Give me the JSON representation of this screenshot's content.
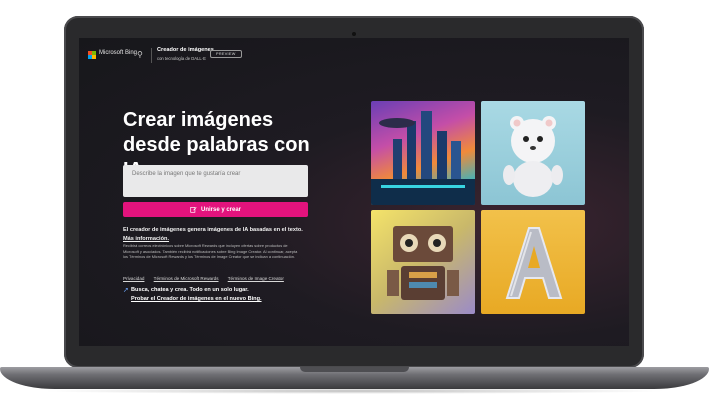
{
  "header": {
    "brand": "Microsoft Bing",
    "app_title": "Creador de imágenes",
    "app_subtitle": "con tecnología de DALL·E",
    "preview_badge": "PREVIEW"
  },
  "hero": {
    "title": "Crear imágenes desde palabras con IA",
    "input_placeholder": "Describe la imagen que te gustaría crear",
    "join_button": "Unirse y crear"
  },
  "description": {
    "text": "El creador de imágenes genera imágenes de IA basadas en el texto.",
    "more_link": "Más información."
  },
  "legal_text": "Recibirá correos electrónicos sobre Microsoft Rewards que incluyen ofertas sobre productos de Microsoft y asociados. También recibirá notificaciones sobre Bing Image Creator. Al continuar, acepta los Términos de Microsoft Rewards y los Términos de Image Creator que se indican a continuación.",
  "footer_links": [
    "Privacidad",
    "Términos de Microsoft Rewards",
    "Términos de Image Creator"
  ],
  "promo": {
    "line1": "Busca, chatea y crea. Todo en un solo lugar.",
    "line2": "Probar el Creador de imágenes en el nuevo Bing."
  },
  "gallery": [
    "futuristic-city-image",
    "polar-bear-image",
    "robot-image",
    "letter-a-balloon-image"
  ],
  "colors": {
    "accent": "#e3137d",
    "background": "#1e1b22"
  }
}
